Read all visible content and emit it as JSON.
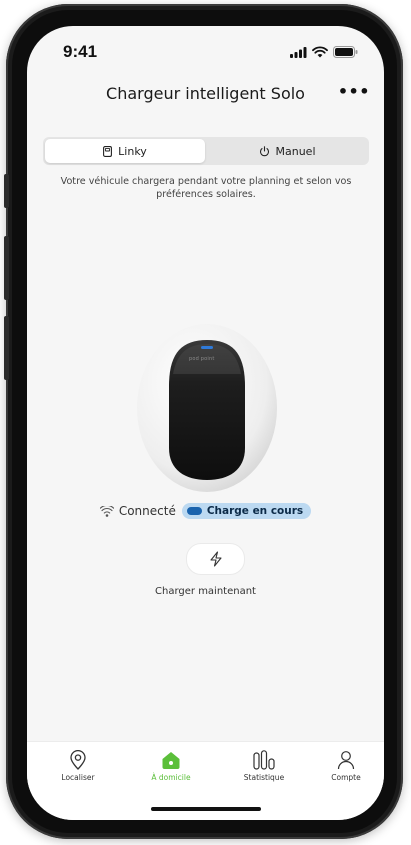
{
  "status_bar": {
    "time": "9:41"
  },
  "header": {
    "title": "Chargeur intelligent Solo",
    "more_label": "•••"
  },
  "mode_tabs": [
    {
      "label": "Linky",
      "icon": "linky-meter-icon",
      "selected": true
    },
    {
      "label": "Manuel",
      "icon": "power-icon",
      "selected": false
    }
  ],
  "description": "Votre véhicule chargera pendant votre planning et selon vos préférences solaires.",
  "charger": {
    "brand": "pod point"
  },
  "status": {
    "connection": "Connecté",
    "badge": "Charge en cours"
  },
  "charge_now": {
    "label": "Charger maintenant",
    "icon": "lightning-icon"
  },
  "tabbar": {
    "items": [
      {
        "label": "Localiser",
        "icon": "location-pin-icon",
        "active": false
      },
      {
        "label": "À domicile",
        "icon": "home-icon",
        "active": true
      },
      {
        "label": "Statistique",
        "icon": "stats-bars-icon",
        "active": false
      },
      {
        "label": "Compte",
        "icon": "user-icon",
        "active": false
      }
    ]
  },
  "colors": {
    "accent_green": "#5bbf3a",
    "badge_bg": "#bcd9f1",
    "badge_dot": "#1a63ad",
    "screen_bg": "#f6f6f6"
  }
}
